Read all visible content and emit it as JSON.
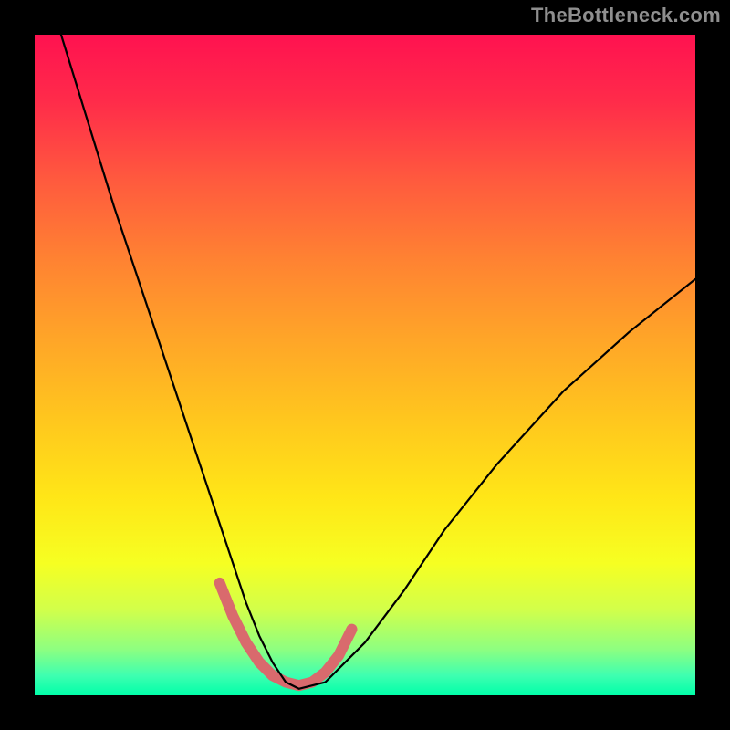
{
  "watermark": {
    "text": "TheBottleneck.com"
  },
  "chart_data": {
    "type": "line",
    "title": "",
    "xlabel": "",
    "ylabel": "",
    "xlim": [
      0,
      100
    ],
    "ylim": [
      0,
      100
    ],
    "grid": false,
    "series": [
      {
        "name": "bottleneck-curve",
        "x": [
          4,
          8,
          12,
          16,
          20,
          24,
          28,
          30,
          32,
          34,
          36,
          38,
          40,
          44,
          50,
          56,
          62,
          70,
          80,
          90,
          100
        ],
        "y": [
          100,
          87,
          74,
          62,
          50,
          38,
          26,
          20,
          14,
          9,
          5,
          2,
          1,
          2,
          8,
          16,
          25,
          35,
          46,
          55,
          63
        ]
      }
    ],
    "accent_segments": [
      {
        "name": "accent-left",
        "x": [
          28,
          30,
          32,
          34,
          36,
          38,
          40
        ],
        "y": [
          17,
          12,
          8,
          5,
          3,
          2,
          1.5
        ]
      },
      {
        "name": "accent-right",
        "x": [
          40,
          42,
          44,
          46,
          48
        ],
        "y": [
          1.5,
          2,
          3.5,
          6,
          10
        ]
      }
    ],
    "background_gradient": {
      "top": "#ff1250",
      "bottom": "#00ffa9",
      "type": "vertical"
    }
  }
}
